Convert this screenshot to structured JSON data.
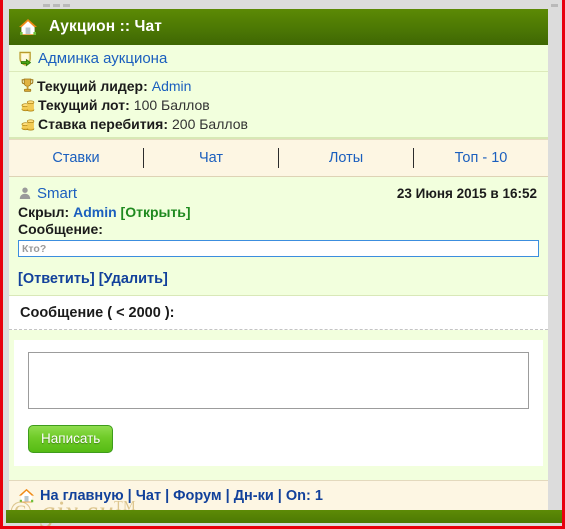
{
  "header": {
    "title": "Аукцион :: Чат",
    "home_icon": "home-icon"
  },
  "admin": {
    "icon": "shield-arrow-icon",
    "label": "Админка аукциона"
  },
  "stats": [
    {
      "icon": "trophy-icon",
      "label": "Текущий лидер:",
      "value": "Admin",
      "value_is_link": true
    },
    {
      "icon": "coins-icon",
      "label": "Текущий лот:",
      "value": "100 Баллов",
      "value_is_link": false
    },
    {
      "icon": "coins-icon",
      "label": "Ставка перебития:",
      "value": "200 Баллов",
      "value_is_link": false
    }
  ],
  "tabs": [
    {
      "label": "Ставки"
    },
    {
      "label": "Чат"
    },
    {
      "label": "Лоты"
    },
    {
      "label": "Топ - 10"
    }
  ],
  "message": {
    "user_icon": "user-icon",
    "username": "Smart",
    "date": "23 Июня 2015 в 16:52",
    "hidden_prefix": "Скрыл:",
    "hidden_by": "Admin",
    "open_label": "[Открыть]",
    "message_label": "Сообщение:",
    "input_value": "Кто?",
    "input_placeholder": "Кто?",
    "reply_label": "[Ответить]",
    "delete_label": "[Удалить]"
  },
  "compose": {
    "title": "Сообщение ( < 2000 ):",
    "textarea_value": "",
    "textarea_placeholder": "",
    "submit_label": "Написать"
  },
  "footer": {
    "home_icon": "home-icon",
    "links": [
      {
        "label": "На главную"
      },
      {
        "label": "Чат"
      },
      {
        "label": "Форум"
      },
      {
        "label": "Дн-ки"
      }
    ],
    "separator": "|",
    "online_label": "On: 1"
  },
  "watermark": {
    "text": "© gix.su",
    "tm": "TM"
  },
  "colors": {
    "header_green": "#4e7a04",
    "panel_green": "#f2ffdd",
    "tab_cream": "#fdf6e3",
    "link_blue": "#1b5fbe",
    "open_green": "#1f8a1f",
    "frame_red": "#e8000d",
    "button_green": "#6fcb28"
  }
}
